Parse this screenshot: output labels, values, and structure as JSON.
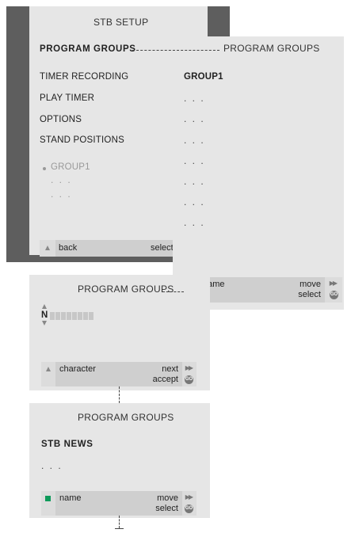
{
  "stb_setup": {
    "title": "STB SETUP",
    "menu": [
      "PROGRAM GROUPS",
      "TIMER RECORDING",
      "PLAY TIMER",
      "OPTIONS",
      "STAND POSITIONS"
    ],
    "group_item": "GROUP1",
    "dots": ". . .",
    "bar": {
      "back": "back",
      "select": "select"
    }
  },
  "program_groups_list": {
    "title": "PROGRAM GROUPS",
    "first_item": "GROUP1",
    "dots": ". . .",
    "bar": {
      "name": "name",
      "move": "move",
      "select": "select",
      "go": "GO"
    }
  },
  "program_groups_edit": {
    "title": "PROGRAM GROUPS",
    "char": "N",
    "bar": {
      "character": "character",
      "next": "next",
      "accept": "accept",
      "go": "GO"
    }
  },
  "program_groups_result": {
    "title": "PROGRAM GROUPS",
    "item": "STB NEWS",
    "dots": ". . .",
    "bar": {
      "name": "name",
      "move": "move",
      "select": "select",
      "go": "GO"
    }
  },
  "colors": {
    "panel": "#e6e6e6",
    "dark": "#5e5e5e",
    "green": "#0e9a5a"
  }
}
